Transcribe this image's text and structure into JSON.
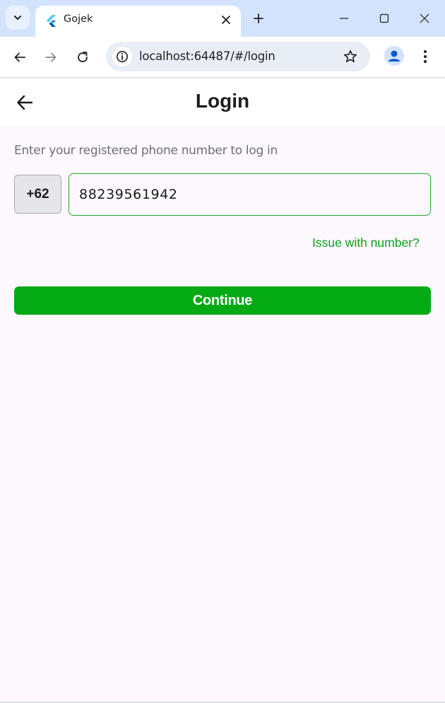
{
  "browser": {
    "tab_title": "Gojek",
    "url": "localhost:64487/#/login"
  },
  "icons": {
    "tab_menu": "chevron-down-icon",
    "favicon": "flutter-icon",
    "tab_close": "close-icon",
    "new_tab": "plus-icon",
    "minimize": "minimize-icon",
    "maximize": "maximize-icon",
    "close_window": "close-icon",
    "back": "arrow-left-icon",
    "forward": "arrow-right-icon",
    "reload": "reload-icon",
    "site_info": "info-icon",
    "bookmark": "star-icon",
    "profile": "person-icon",
    "menu": "kebab-icon",
    "app_back": "arrow-left-icon"
  },
  "login": {
    "title": "Login",
    "instruction": "Enter your registered phone number to log in",
    "country_code": "+62",
    "phone_value": "88239561942",
    "issue_link": "Issue with number?",
    "continue_label": "Continue"
  },
  "colors": {
    "accent_green": "#03aa14",
    "link_green": "#08a41b",
    "background": "#fdf7fe",
    "tabstrip": "#d3e3fd"
  }
}
